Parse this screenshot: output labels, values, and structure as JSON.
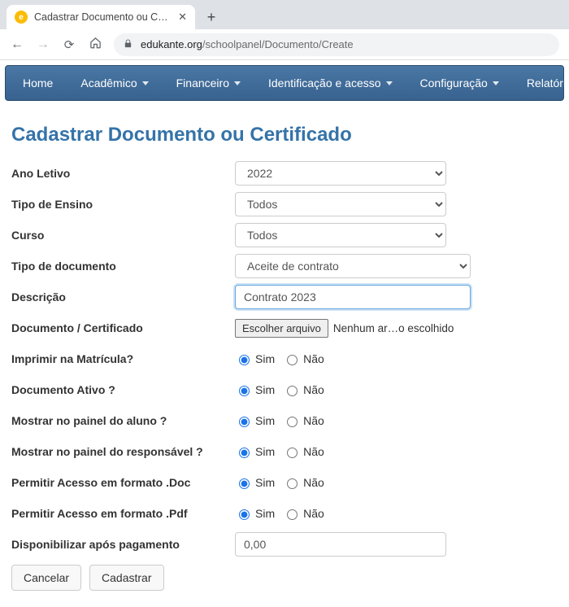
{
  "browser": {
    "tab_title": "Cadastrar Documento ou Certific",
    "url_domain": "edukante.org",
    "url_path": "/schoolpanel/Documento/Create"
  },
  "navbar": {
    "items": [
      {
        "label": "Home",
        "dropdown": false
      },
      {
        "label": "Acadêmico",
        "dropdown": true
      },
      {
        "label": "Financeiro",
        "dropdown": true
      },
      {
        "label": "Identificação e acesso",
        "dropdown": true
      },
      {
        "label": "Configuração",
        "dropdown": true
      },
      {
        "label": "Relatórios",
        "dropdown": true
      }
    ]
  },
  "page": {
    "title": "Cadastrar Documento ou Certificado"
  },
  "form": {
    "ano_letivo": {
      "label": "Ano Letivo",
      "value": "2022"
    },
    "tipo_ensino": {
      "label": "Tipo de Ensino",
      "value": "Todos"
    },
    "curso": {
      "label": "Curso",
      "value": "Todos"
    },
    "tipo_documento": {
      "label": "Tipo de documento",
      "value": "Aceite de contrato"
    },
    "descricao": {
      "label": "Descrição",
      "value": "Contrato 2023"
    },
    "doc_cert": {
      "label": "Documento / Certificado",
      "button": "Escolher arquivo",
      "status": "Nenhum ar…o escolhido"
    },
    "imprimir_matricula": {
      "label": "Imprimir na Matrícula?",
      "sim": "Sim",
      "nao": "Não",
      "value": "sim"
    },
    "documento_ativo": {
      "label": "Documento Ativo ?",
      "sim": "Sim",
      "nao": "Não",
      "value": "sim"
    },
    "mostrar_aluno": {
      "label": "Mostrar no painel do aluno ?",
      "sim": "Sim",
      "nao": "Não",
      "value": "sim"
    },
    "mostrar_responsavel": {
      "label": "Mostrar no painel do responsável ?",
      "sim": "Sim",
      "nao": "Não",
      "value": "sim"
    },
    "acesso_doc": {
      "label": "Permitir Acesso em formato .Doc",
      "sim": "Sim",
      "nao": "Não",
      "value": "sim"
    },
    "acesso_pdf": {
      "label": "Permitir Acesso em formato .Pdf",
      "sim": "Sim",
      "nao": "Não",
      "value": "sim"
    },
    "disponibilizar": {
      "label": "Disponibilizar após pagamento",
      "value": "0,00"
    }
  },
  "buttons": {
    "cancel": "Cancelar",
    "submit": "Cadastrar"
  }
}
